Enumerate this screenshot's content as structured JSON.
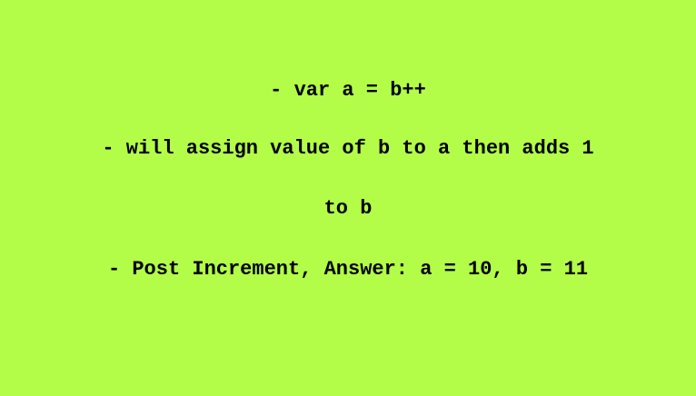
{
  "background_color": "#b3fd49",
  "text_color": "#000000",
  "lines": [
    "- var a = b++",
    "- will assign value of b to a then adds 1",
    "to b",
    "- Post Increment, Answer: a = 10, b = 11"
  ]
}
